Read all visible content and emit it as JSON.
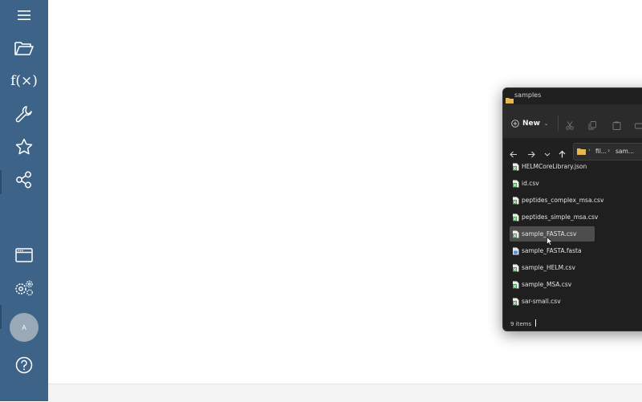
{
  "sidebar": {
    "items": [
      {
        "name": "menu-icon"
      },
      {
        "name": "folder-open-icon"
      },
      {
        "name": "function-icon",
        "label": "f(×)"
      },
      {
        "name": "wrench-icon"
      },
      {
        "name": "star-icon"
      },
      {
        "name": "share-icon"
      },
      {
        "name": "browser-window-icon"
      },
      {
        "name": "settings-gears-icon"
      },
      {
        "name": "help-icon"
      }
    ],
    "avatar_label": "A",
    "background": "#3d6388"
  },
  "explorer": {
    "title": "samples",
    "toolbar": {
      "new_label": "New"
    },
    "address": {
      "crumbs": [
        "fil...",
        "sam..."
      ]
    },
    "files": [
      {
        "name": "HELMCoreLibrary.json",
        "type": "json",
        "selected": false
      },
      {
        "name": "id.csv",
        "type": "csv",
        "selected": false
      },
      {
        "name": "peptides_complex_msa.csv",
        "type": "csv",
        "selected": false
      },
      {
        "name": "peptides_simple_msa.csv",
        "type": "csv",
        "selected": false
      },
      {
        "name": "sample_FASTA.csv",
        "type": "csv",
        "selected": true
      },
      {
        "name": "sample_FASTA.fasta",
        "type": "fasta",
        "selected": false
      },
      {
        "name": "sample_HELM.csv",
        "type": "csv",
        "selected": false
      },
      {
        "name": "sample_MSA.csv",
        "type": "csv",
        "selected": false
      },
      {
        "name": "sar-small.csv",
        "type": "csv",
        "selected": false
      }
    ],
    "status": "9 items",
    "colors": {
      "background": "#1f1f1f",
      "selected_row": "#4d4d4d",
      "folder": "#e8b64c",
      "csv_icon": "#3fa34d"
    }
  }
}
